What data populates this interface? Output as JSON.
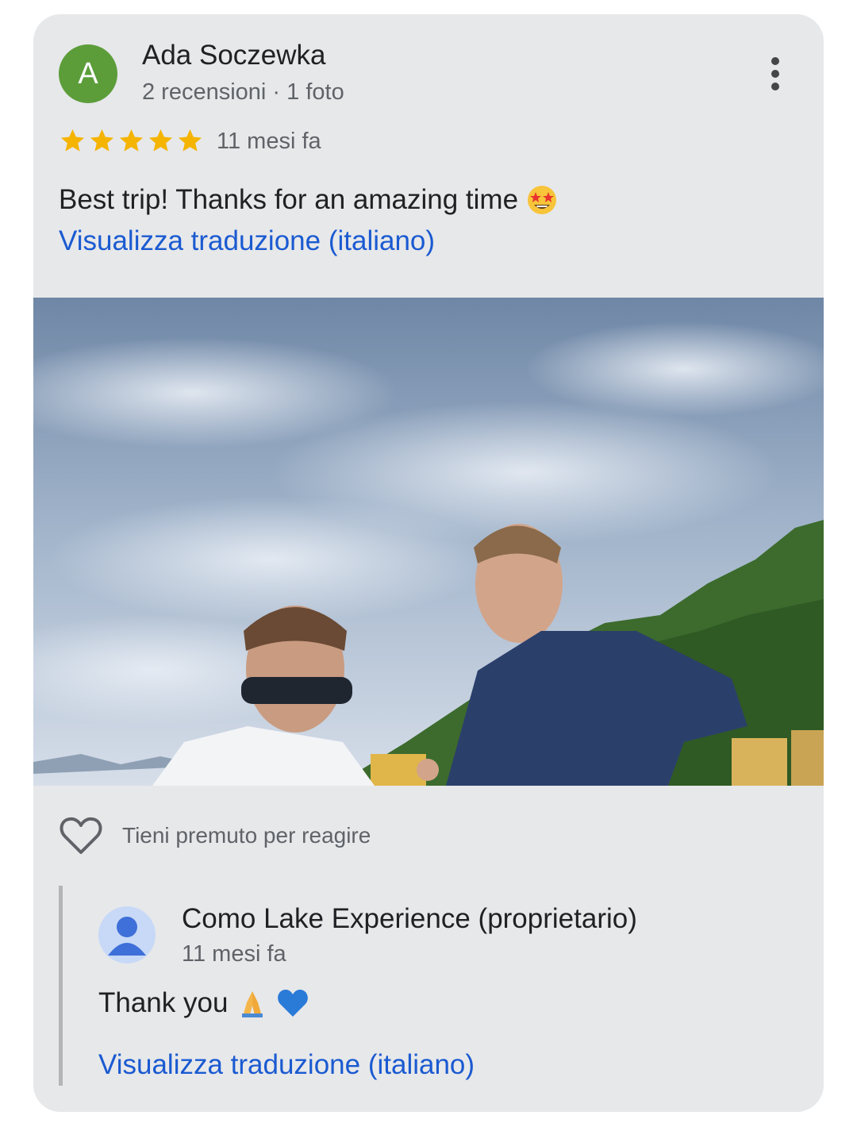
{
  "review": {
    "avatar_letter": "A",
    "avatar_color": "#5c9d3a",
    "author": "Ada Soczewka",
    "meta": "2 recensioni · 1 foto",
    "rating": 5,
    "star_color": "#f4b400",
    "time": "11 mesi fa",
    "text": "Best trip! Thanks for an amazing time",
    "text_emoji": "star-struck-emoji",
    "translate_label": "Visualizza traduzione (italiano)",
    "more_icon": "more-vert-icon"
  },
  "photo": {
    "description_icon": "review-photo"
  },
  "reaction": {
    "icon": "heart-outline-icon",
    "label": "Tieni premuto per reagire"
  },
  "owner_reply": {
    "name": "Como Lake Experience (proprietario)",
    "time": "11 mesi fa",
    "text": "Thank you",
    "emojis": [
      "folded-hands-emoji",
      "blue-heart-emoji"
    ],
    "translate_label": "Visualizza traduzione (italiano)",
    "avatar_icon": "person-icon"
  },
  "colors": {
    "card_bg": "#e7e8ea",
    "link": "#1a5ad1",
    "text": "#202124",
    "secondary": "#5f6368"
  }
}
